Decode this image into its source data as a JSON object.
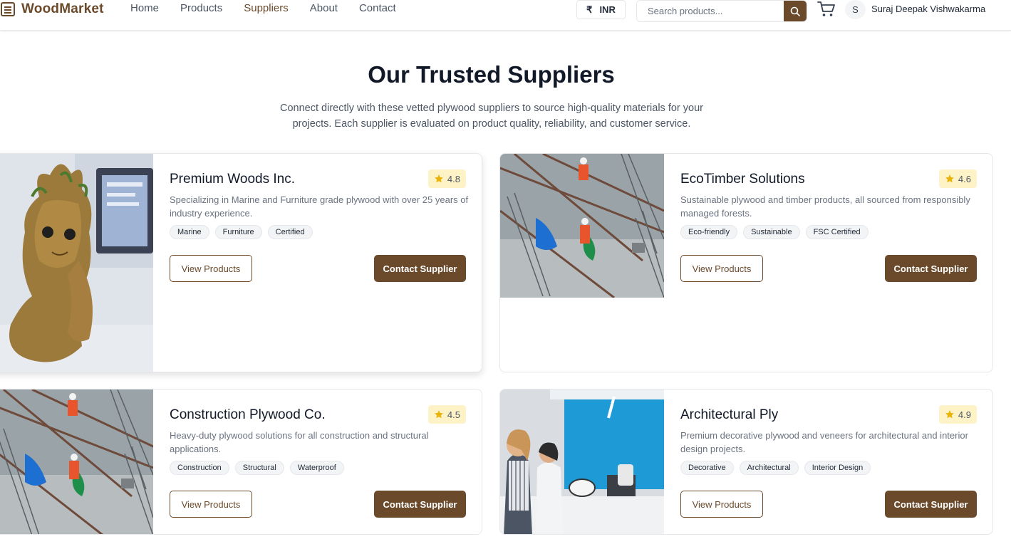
{
  "brand": {
    "name": "WoodMarket",
    "color": "#6b4a2b"
  },
  "nav": {
    "links": [
      {
        "label": "Home"
      },
      {
        "label": "Products"
      },
      {
        "label": "Suppliers",
        "active": true
      },
      {
        "label": "About"
      },
      {
        "label": "Contact"
      }
    ]
  },
  "currency": {
    "symbol": "₹",
    "code": "INR"
  },
  "search": {
    "placeholder": "Search products...",
    "icon": "search-icon"
  },
  "cart": {
    "icon": "cart-icon"
  },
  "user": {
    "initial": "S",
    "name": "Suraj Deepak Vishwakarma"
  },
  "hero": {
    "title": "Our Trusted Suppliers",
    "subtitle": "Connect directly with these vetted plywood suppliers to source high-quality materials for your projects. Each supplier is evaluated on product quality, reliability, and customer service."
  },
  "suppliers": [
    {
      "name": "Premium Woods Inc.",
      "rating": "4.8",
      "description": "Specializing in Marine and Furniture grade plywood with over 25 years of industry experience.",
      "tags": [
        "Marine",
        "Furniture",
        "Certified"
      ],
      "view_label": "View Products",
      "contact_label": "Contact Supplier",
      "image": "wooden-figurine-photo"
    },
    {
      "name": "EcoTimber Solutions",
      "rating": "4.6",
      "description": "Sustainable plywood and timber products, all sourced from responsibly managed forests.",
      "tags": [
        "Eco-friendly",
        "Sustainable",
        "FSC Certified"
      ],
      "view_label": "View Products",
      "contact_label": "Contact Supplier",
      "image": "construction-site-photo"
    },
    {
      "name": "Construction Plywood Co.",
      "rating": "4.5",
      "description": "Heavy-duty plywood solutions for all construction and structural applications.",
      "tags": [
        "Construction",
        "Structural",
        "Waterproof"
      ],
      "view_label": "View Products",
      "contact_label": "Contact Supplier",
      "image": "construction-site-photo"
    },
    {
      "name": "Architectural Ply",
      "rating": "4.9",
      "description": "Premium decorative plywood and veneers for architectural and interior design projects.",
      "tags": [
        "Decorative",
        "Architectural",
        "Interior Design"
      ],
      "view_label": "View Products",
      "contact_label": "Contact Supplier",
      "image": "lab-people-photo"
    }
  ],
  "colors": {
    "accent": "#6b4a2b",
    "rating_bg": "#fef3c7",
    "star": "#eab308"
  }
}
